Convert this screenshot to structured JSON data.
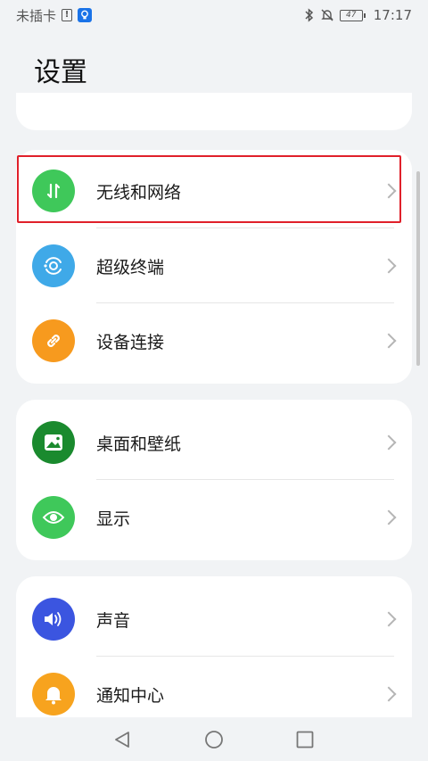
{
  "status_bar": {
    "carrier": "未插卡",
    "battery": "47",
    "time": "17:17"
  },
  "title": "设置",
  "sections": [
    {
      "items": [
        {
          "label": "无线和网络",
          "icon": "wireless-network-icon",
          "color": "#3fc85a",
          "highlighted": true
        },
        {
          "label": "超级终端",
          "icon": "super-device-icon",
          "color": "#3fa9e8"
        },
        {
          "label": "设备连接",
          "icon": "link-icon",
          "color": "#f79a1e"
        }
      ]
    },
    {
      "items": [
        {
          "label": "桌面和壁纸",
          "icon": "wallpaper-icon",
          "color": "#1a8a2e"
        },
        {
          "label": "显示",
          "icon": "eye-icon",
          "color": "#3fc85a"
        }
      ]
    },
    {
      "items": [
        {
          "label": "声音",
          "icon": "speaker-icon",
          "color": "#3b55e0"
        },
        {
          "label": "通知中心",
          "icon": "bell-icon",
          "color": "#f7a31e"
        }
      ]
    }
  ],
  "nav": {
    "back": "back-icon",
    "home": "home-icon",
    "recent": "recent-apps-icon"
  }
}
